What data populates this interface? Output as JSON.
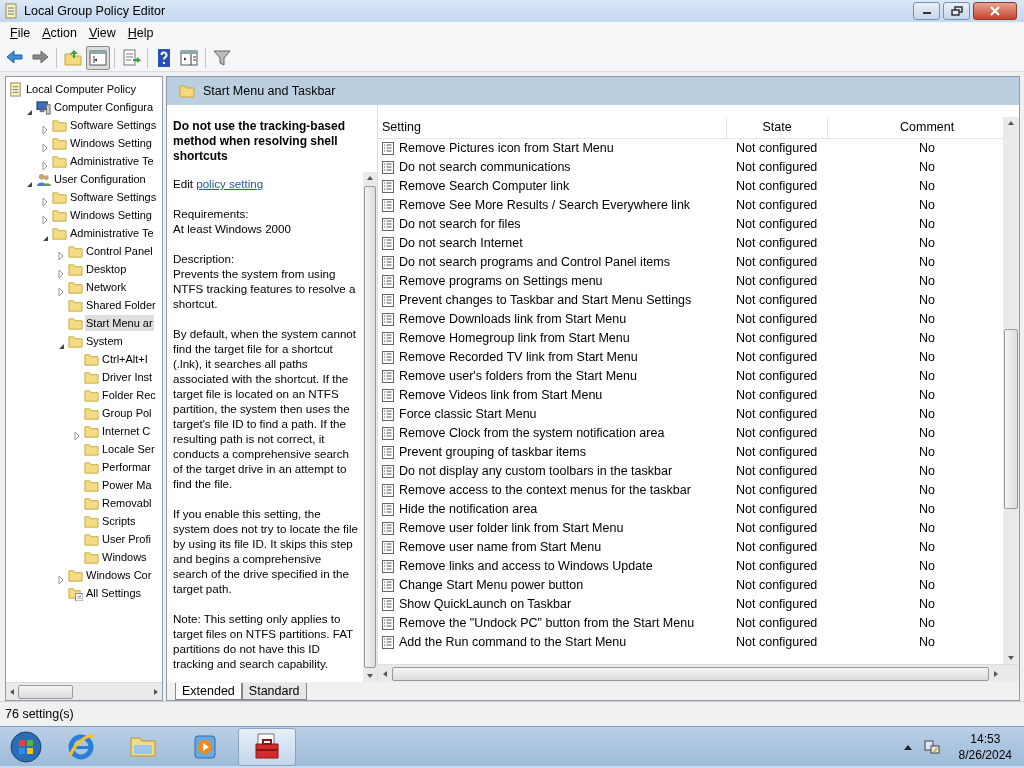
{
  "window": {
    "title": "Local Group Policy Editor"
  },
  "menu": [
    {
      "label": "File"
    },
    {
      "label": "Action"
    },
    {
      "label": "View"
    },
    {
      "label": "Help"
    }
  ],
  "toolbar": [
    {
      "kind": "back",
      "pressed": false
    },
    {
      "kind": "forward",
      "pressed": false
    },
    {
      "kind": "up",
      "pressed": false
    },
    {
      "kind": "tree",
      "pressed": true
    },
    {
      "kind": "export",
      "pressed": false
    },
    {
      "kind": "help",
      "pressed": false
    },
    {
      "kind": "pane",
      "pressed": false
    },
    {
      "kind": "filter",
      "pressed": false
    }
  ],
  "tree": [
    {
      "label": "Local Computer Policy",
      "kind": "policy",
      "expandable": false,
      "selected": false,
      "children": [
        {
          "label": "Computer Configura",
          "kind": "computer",
          "expandable": true,
          "expanded": true,
          "selected": false,
          "children": [
            {
              "label": "Software Settings",
              "kind": "folder",
              "expandable": true,
              "expanded": false,
              "selected": false
            },
            {
              "label": "Windows Setting",
              "kind": "folder",
              "expandable": true,
              "expanded": false,
              "selected": false
            },
            {
              "label": "Administrative Te",
              "kind": "folder",
              "expandable": true,
              "expanded": false,
              "selected": false
            }
          ]
        },
        {
          "label": "User Configuration",
          "kind": "users",
          "expandable": true,
          "expanded": true,
          "selected": false,
          "children": [
            {
              "label": "Software Settings",
              "kind": "folder",
              "expandable": true,
              "expanded": false,
              "selected": false
            },
            {
              "label": "Windows Setting",
              "kind": "folder",
              "expandable": true,
              "expanded": false,
              "selected": false
            },
            {
              "label": "Administrative Te",
              "kind": "folder",
              "expandable": true,
              "expanded": true,
              "selected": false,
              "children": [
                {
                  "label": "Control Panel",
                  "kind": "folder",
                  "expandable": true,
                  "expanded": false,
                  "selected": false
                },
                {
                  "label": "Desktop",
                  "kind": "folder",
                  "expandable": true,
                  "expanded": false,
                  "selected": false
                },
                {
                  "label": "Network",
                  "kind": "folder",
                  "expandable": true,
                  "expanded": false,
                  "selected": false
                },
                {
                  "label": "Shared Folder",
                  "kind": "folder",
                  "expandable": false,
                  "selected": false
                },
                {
                  "label": "Start Menu ar",
                  "kind": "folder",
                  "expandable": false,
                  "selected": true
                },
                {
                  "label": "System",
                  "kind": "folder",
                  "expandable": true,
                  "expanded": true,
                  "selected": false,
                  "children": [
                    {
                      "label": "Ctrl+Alt+I",
                      "kind": "folder",
                      "expandable": false,
                      "selected": false
                    },
                    {
                      "label": "Driver Inst",
                      "kind": "folder",
                      "expandable": false,
                      "selected": false
                    },
                    {
                      "label": "Folder Rec",
                      "kind": "folder",
                      "expandable": false,
                      "selected": false
                    },
                    {
                      "label": "Group Pol",
                      "kind": "folder",
                      "expandable": false,
                      "selected": false
                    },
                    {
                      "label": "Internet C",
                      "kind": "folder",
                      "expandable": true,
                      "expanded": false,
                      "selected": false
                    },
                    {
                      "label": "Locale Ser",
                      "kind": "folder",
                      "expandable": false,
                      "selected": false
                    },
                    {
                      "label": "Performar",
                      "kind": "folder",
                      "expandable": false,
                      "selected": false
                    },
                    {
                      "label": "Power Ma",
                      "kind": "folder",
                      "expandable": false,
                      "selected": false
                    },
                    {
                      "label": "Removabl",
                      "kind": "folder",
                      "expandable": false,
                      "selected": false
                    },
                    {
                      "label": "Scripts",
                      "kind": "folder",
                      "expandable": false,
                      "selected": false
                    },
                    {
                      "label": "User Profi",
                      "kind": "folder",
                      "expandable": false,
                      "selected": false
                    },
                    {
                      "label": "Windows",
                      "kind": "folder",
                      "expandable": false,
                      "selected": false
                    }
                  ]
                },
                {
                  "label": "Windows Cor",
                  "kind": "folder",
                  "expandable": true,
                  "expanded": false,
                  "selected": false
                },
                {
                  "label": "All Settings",
                  "kind": "all-settings",
                  "expandable": false,
                  "selected": false
                }
              ]
            }
          ]
        }
      ]
    }
  ],
  "details": {
    "header": "Start Menu and Taskbar",
    "title": "Do not use the tracking-based method when resolving shell shortcuts",
    "edit_prefix": "Edit",
    "edit_link": "policy setting",
    "paragraphs": [
      "Requirements:\nAt least Windows 2000",
      "Description:\nPrevents the system from using NTFS tracking features to resolve a shortcut.",
      "By default, when the system cannot find the target file for a shortcut (.lnk), it searches all paths associated with the shortcut. If the target file is located on an NTFS partition, the system then uses the target's file ID to find a path. If the resulting path is not correct, it conducts a comprehensive search of the target drive in an attempt to find the file.",
      "If you enable this setting, the system does not try to locate the file by using its file ID. It skips this step and begins a comprehensive search of the drive specified in the target path.",
      "Note: This setting only applies to target files on NTFS partitions. FAT partitions do not have this ID tracking and search capability."
    ]
  },
  "table": {
    "columns": [
      "Setting",
      "State",
      "Comment"
    ],
    "rows": [
      [
        "Remove Pictures icon from Start Menu",
        "Not configured",
        "No"
      ],
      [
        "Do not search communications",
        "Not configured",
        "No"
      ],
      [
        "Remove Search Computer link",
        "Not configured",
        "No"
      ],
      [
        "Remove See More Results / Search Everywhere link",
        "Not configured",
        "No"
      ],
      [
        "Do not search for files",
        "Not configured",
        "No"
      ],
      [
        "Do not search Internet",
        "Not configured",
        "No"
      ],
      [
        "Do not search programs and Control Panel items",
        "Not configured",
        "No"
      ],
      [
        "Remove programs on Settings menu",
        "Not configured",
        "No"
      ],
      [
        "Prevent changes to Taskbar and Start Menu Settings",
        "Not configured",
        "No"
      ],
      [
        "Remove Downloads link from Start Menu",
        "Not configured",
        "No"
      ],
      [
        "Remove Homegroup link from Start Menu",
        "Not configured",
        "No"
      ],
      [
        "Remove Recorded TV link from Start Menu",
        "Not configured",
        "No"
      ],
      [
        "Remove user's folders from the Start Menu",
        "Not configured",
        "No"
      ],
      [
        "Remove Videos link from Start Menu",
        "Not configured",
        "No"
      ],
      [
        "Force classic Start Menu",
        "Not configured",
        "No"
      ],
      [
        "Remove Clock from the system notification area",
        "Not configured",
        "No"
      ],
      [
        "Prevent grouping of taskbar items",
        "Not configured",
        "No"
      ],
      [
        "Do not display any custom toolbars in the taskbar",
        "Not configured",
        "No"
      ],
      [
        "Remove access to the context menus for the taskbar",
        "Not configured",
        "No"
      ],
      [
        "Hide the notification area",
        "Not configured",
        "No"
      ],
      [
        "Remove user folder link from Start Menu",
        "Not configured",
        "No"
      ],
      [
        "Remove user name from Start Menu",
        "Not configured",
        "No"
      ],
      [
        "Remove links and access to Windows Update",
        "Not configured",
        "No"
      ],
      [
        "Change Start Menu power button",
        "Not configured",
        "No"
      ],
      [
        "Show QuickLaunch on Taskbar",
        "Not configured",
        "No"
      ],
      [
        "Remove the \"Undock PC\" button from the Start Menu",
        "Not configured",
        "No"
      ],
      [
        "Add the Run command to the Start Menu",
        "Not configured",
        "No"
      ]
    ]
  },
  "view_tabs": [
    {
      "label": "Extended",
      "selected": true
    },
    {
      "label": "Standard",
      "selected": false
    }
  ],
  "status_bar": "76 setting(s)",
  "taskbar": {
    "apps": [
      {
        "kind": "ie",
        "active": false
      },
      {
        "kind": "explorer",
        "active": false
      },
      {
        "kind": "media",
        "active": false
      },
      {
        "kind": "gpedit",
        "active": true
      }
    ],
    "time": "14:53",
    "date": "8/26/2024"
  }
}
